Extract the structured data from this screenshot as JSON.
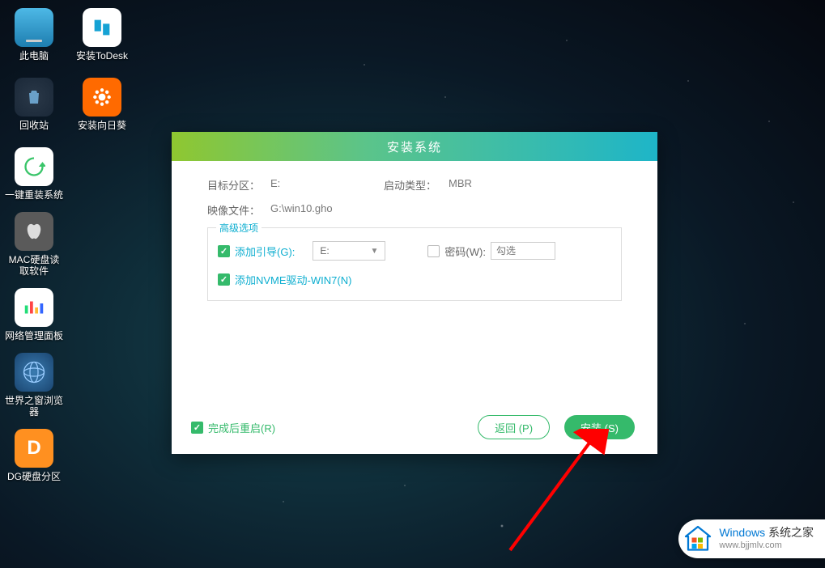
{
  "desktop": {
    "icons": [
      {
        "label": "此电脑"
      },
      {
        "label": "安装ToDesk"
      },
      {
        "label": "回收站"
      },
      {
        "label": "安装向日葵"
      },
      {
        "label": "一键重装系统"
      },
      {
        "label": "MAC硬盘读取软件"
      },
      {
        "label": "网络管理面板"
      },
      {
        "label": "世界之窗浏览器"
      },
      {
        "label": "DG硬盘分区"
      }
    ]
  },
  "dialog": {
    "title": "安装系统",
    "target_partition_label": "目标分区：",
    "target_partition_value": "E:",
    "boot_type_label": "启动类型：",
    "boot_type_value": "MBR",
    "image_file_label": "映像文件：",
    "image_file_value": "G:\\win10.gho",
    "advanced": {
      "legend": "高级选项",
      "add_boot_label": "添加引导(G):",
      "add_boot_select": "E:",
      "password_label": "密码(W):",
      "password_placeholder": "勾选",
      "add_nvme_label": "添加NVME驱动-WIN7(N)"
    },
    "restart_label": "完成后重启(R)",
    "return_btn": "返回 (P)",
    "install_btn": "安装 (S)"
  },
  "watermark": {
    "brand1": "Windows",
    "brand2": " 系统之家",
    "url": "www.bjjmlv.com"
  }
}
